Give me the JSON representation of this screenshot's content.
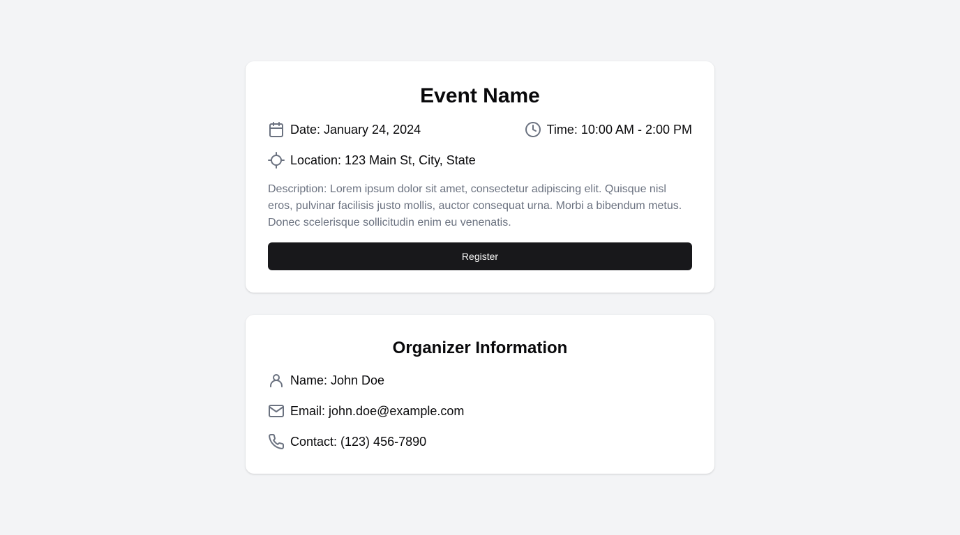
{
  "event": {
    "title": "Event Name",
    "date_text": "Date: January 24, 2024",
    "time_text": "Time: 10:00 AM - 2:00 PM",
    "location_text": "Location: 123 Main St, City, State",
    "description": "Description: Lorem ipsum dolor sit amet, consectetur adipiscing elit. Quisque nisl eros, pulvinar facilisis justo mollis, auctor consequat urna. Morbi a bibendum metus. Donec scelerisque sollicitudin enim eu venenatis.",
    "register_label": "Register"
  },
  "organizer": {
    "title": "Organizer Information",
    "name_text": "Name: John Doe",
    "email_text": "Email: john.doe@example.com",
    "contact_text": "Contact: (123) 456-7890"
  },
  "icons": {
    "date": "calendar-icon",
    "time": "clock-icon",
    "location": "crosshair-icon",
    "name": "user-icon",
    "email": "mail-icon",
    "contact": "phone-icon"
  },
  "colors": {
    "page_background": "#f3f4f6",
    "card_background": "#ffffff",
    "primary_button": "#18181b",
    "muted_text": "#6b7280",
    "icon": "#6b7280"
  }
}
